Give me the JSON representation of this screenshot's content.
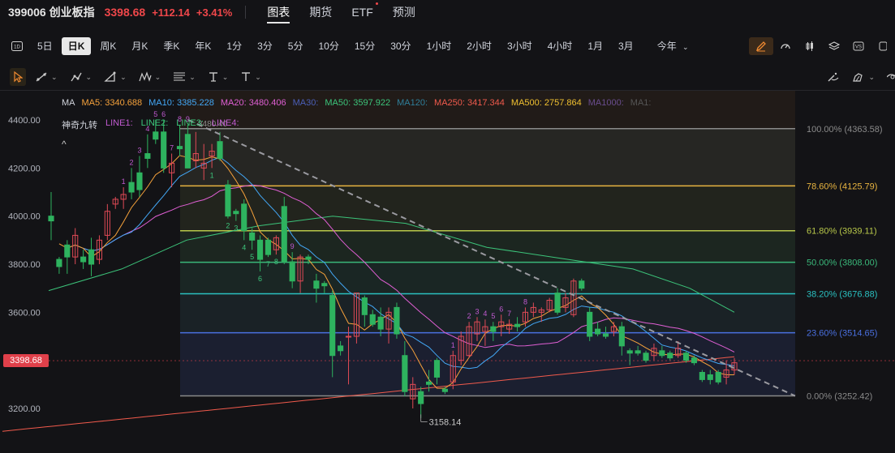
{
  "header": {
    "symbol": "399006 创业板指",
    "price": "3398.68",
    "change": "+112.14",
    "percent": "+3.41%",
    "nav": [
      "图表",
      "期货",
      "ETF",
      "预测"
    ],
    "active_nav": 0,
    "colors": {
      "up": "#f0474a"
    }
  },
  "periods": {
    "items": [
      "5日",
      "日K",
      "周K",
      "月K",
      "季K",
      "年K",
      "1分",
      "3分",
      "5分",
      "10分",
      "15分",
      "30分",
      "1小时",
      "2小时",
      "3小时",
      "4小时",
      "1月",
      "3月"
    ],
    "active": 1,
    "range_select": "今年",
    "left_icon": "1d-icon",
    "right_icons": [
      "pen-icon",
      "gauge-icon",
      "candles-icon",
      "layers-icon",
      "vs-icon",
      "extra-icon"
    ]
  },
  "drawbar": {
    "tools": [
      "cursor-icon",
      "line-icon",
      "brush-icon",
      "triangle-icon",
      "pattern-icon",
      "fib-icon",
      "text-icon",
      "text-style-icon"
    ],
    "right_tools": [
      "magic-icon",
      "alert-icon",
      "eye-icon"
    ]
  },
  "legend": {
    "ma": [
      {
        "label": "MA",
        "color": "#d1d4dc"
      },
      {
        "label": "MA5: 3340.688",
        "color": "#f6a23b"
      },
      {
        "label": "MA10: 3385.228",
        "color": "#43a7f5"
      },
      {
        "label": "MA20: 3480.406",
        "color": "#e05fd4"
      },
      {
        "label": "MA30:",
        "color": "#4b5fb8"
      },
      {
        "label": "MA50: 3597.922",
        "color": "#3cc47a"
      },
      {
        "label": "MA120:",
        "color": "#2f7f9a"
      },
      {
        "label": "MA250: 3417.344",
        "color": "#f05a4c"
      },
      {
        "label": "MA500: 2757.864",
        "color": "#f0c030"
      },
      {
        "label": "MA1000:",
        "color": "#6a4d8f"
      },
      {
        "label": "MA1:",
        "color": "#555"
      }
    ],
    "nine": [
      {
        "label": "神奇九转",
        "color": "#d1d4dc"
      },
      {
        "label": "LINE1:",
        "color": "#c05ad0"
      },
      {
        "label": "LINE2:",
        "color": "#3cc47a"
      },
      {
        "label": "LINE3:",
        "color": "#3cc47a"
      },
      {
        "label": "LINE4:",
        "color": "#c05ad0"
      }
    ],
    "caret": "^"
  },
  "current_price_label": "3398.68",
  "chart_data": {
    "type": "candlestick",
    "y_ticks": [
      {
        "label": "4400.00",
        "value": 4400
      },
      {
        "label": "4200.00",
        "value": 4200
      },
      {
        "label": "4000.00",
        "value": 4000
      },
      {
        "label": "3800.00",
        "value": 3800
      },
      {
        "label": "3600.00",
        "value": 3600
      },
      {
        "label": "3200.00",
        "value": 3200
      }
    ],
    "ylim": [
      3120,
      4470
    ],
    "colors": {
      "up": "#e04a56",
      "down": "#2eb35f"
    },
    "fib_levels": [
      {
        "label": "100.00% (4363.58)",
        "value": 4363.58,
        "color": "#8a8a8a"
      },
      {
        "label": "78.60% (4125.79)",
        "value": 4125.79,
        "color": "#e8b440"
      },
      {
        "label": "61.80% (3939.11)",
        "value": 3939.11,
        "color": "#b8c84a"
      },
      {
        "label": "50.00% (3808.00)",
        "value": 3808.0,
        "color": "#3ab87a"
      },
      {
        "label": "38.20% (3676.88)",
        "value": 3676.88,
        "color": "#2ac0c0"
      },
      {
        "label": "23.60% (3514.65)",
        "value": 3514.65,
        "color": "#4a70e0"
      },
      {
        "label": "0.00% (3252.42)",
        "value": 3252.42,
        "color": "#8a8a8a"
      }
    ],
    "annotations": [
      {
        "text": "3480.40",
        "value": 4380
      },
      {
        "text": "3158.14",
        "value": 3158.14
      }
    ],
    "candles": [
      [
        4000,
        4100,
        3900,
        3980
      ],
      [
        3820,
        3830,
        3760,
        3790
      ],
      [
        3880,
        3900,
        3760,
        3830
      ],
      [
        3830,
        3950,
        3800,
        3920
      ],
      [
        3830,
        3860,
        3780,
        3810
      ],
      [
        3860,
        3910,
        3750,
        3800
      ],
      [
        3820,
        3920,
        3800,
        3900
      ],
      [
        3920,
        4050,
        3900,
        4020
      ],
      [
        4050,
        4080,
        4030,
        4070
      ],
      [
        4070,
        4120,
        4030,
        4090
      ],
      [
        4140,
        4200,
        4070,
        4100
      ],
      [
        4180,
        4250,
        4080,
        4110
      ],
      [
        4260,
        4340,
        4200,
        4240
      ],
      [
        4350,
        4400,
        4300,
        4320
      ],
      [
        4350,
        4400,
        4180,
        4200
      ],
      [
        4180,
        4260,
        4120,
        4220
      ],
      [
        4290,
        4380,
        4250,
        4280
      ],
      [
        4340,
        4380,
        4200,
        4200
      ],
      [
        4230,
        4350,
        4200,
        4260
      ],
      [
        4200,
        4300,
        4150,
        4220
      ],
      [
        4250,
        4300,
        4200,
        4270
      ],
      [
        4310,
        4350,
        4230,
        4240
      ],
      [
        4130,
        4150,
        3990,
        4000
      ],
      [
        4020,
        4030,
        3980,
        4010
      ],
      [
        4050,
        4070,
        3900,
        3940
      ],
      [
        3930,
        3950,
        3860,
        3900
      ],
      [
        3900,
        3920,
        3770,
        3820
      ],
      [
        3900,
        3910,
        3830,
        3840
      ],
      [
        3860,
        3920,
        3840,
        3910
      ],
      [
        4040,
        4080,
        3800,
        3810
      ],
      [
        3810,
        3850,
        3700,
        3730
      ],
      [
        3730,
        3840,
        3680,
        3830
      ],
      [
        3830,
        3840,
        3800,
        3820
      ],
      [
        3730,
        3760,
        3640,
        3700
      ],
      [
        3720,
        3730,
        3680,
        3710
      ],
      [
        3670,
        3690,
        3330,
        3420
      ],
      [
        3460,
        3480,
        3420,
        3440
      ],
      [
        3500,
        3540,
        3300,
        3500
      ],
      [
        3500,
        3680,
        3470,
        3680
      ],
      [
        3660,
        3670,
        3540,
        3590
      ],
      [
        3590,
        3610,
        3540,
        3550
      ],
      [
        3580,
        3620,
        3500,
        3530
      ],
      [
        3530,
        3620,
        3470,
        3600
      ],
      [
        3620,
        3640,
        3490,
        3510
      ],
      [
        3420,
        3480,
        3250,
        3270
      ],
      [
        3240,
        3330,
        3200,
        3300
      ],
      [
        3270,
        3290,
        3160,
        3220
      ],
      [
        3310,
        3360,
        3270,
        3300
      ],
      [
        3400,
        3410,
        3300,
        3330
      ],
      [
        3280,
        3290,
        3260,
        3270
      ],
      [
        3310,
        3440,
        3280,
        3420
      ],
      [
        3400,
        3520,
        3380,
        3500
      ],
      [
        3420,
        3560,
        3410,
        3540
      ],
      [
        3510,
        3580,
        3480,
        3560
      ],
      [
        3520,
        3570,
        3460,
        3540
      ],
      [
        3540,
        3560,
        3480,
        3520
      ],
      [
        3540,
        3590,
        3500,
        3560
      ],
      [
        3530,
        3570,
        3510,
        3550
      ],
      [
        3550,
        3580,
        3520,
        3540
      ],
      [
        3560,
        3620,
        3540,
        3600
      ],
      [
        3600,
        3640,
        3580,
        3620
      ],
      [
        3600,
        3620,
        3560,
        3610
      ],
      [
        3610,
        3660,
        3600,
        3650
      ],
      [
        3680,
        3700,
        3590,
        3600
      ],
      [
        3620,
        3680,
        3600,
        3660
      ],
      [
        3590,
        3740,
        3580,
        3730
      ],
      [
        3730,
        3740,
        3690,
        3700
      ],
      [
        3600,
        3620,
        3480,
        3500
      ],
      [
        3530,
        3560,
        3500,
        3510
      ],
      [
        3510,
        3540,
        3490,
        3500
      ],
      [
        3520,
        3560,
        3500,
        3540
      ],
      [
        3540,
        3560,
        3420,
        3460
      ],
      [
        3440,
        3450,
        3380,
        3430
      ],
      [
        3440,
        3460,
        3420,
        3430
      ],
      [
        3430,
        3440,
        3390,
        3400
      ],
      [
        3420,
        3470,
        3400,
        3450
      ],
      [
        3440,
        3460,
        3410,
        3420
      ],
      [
        3430,
        3440,
        3400,
        3410
      ],
      [
        3420,
        3480,
        3410,
        3450
      ],
      [
        3430,
        3440,
        3390,
        3400
      ],
      [
        3410,
        3420,
        3380,
        3390
      ],
      [
        3350,
        3360,
        3310,
        3320
      ],
      [
        3340,
        3360,
        3300,
        3320
      ],
      [
        3350,
        3360,
        3300,
        3310
      ],
      [
        3330,
        3400,
        3300,
        3360
      ],
      [
        3360,
        3410,
        3340,
        3390
      ]
    ],
    "nine_labels": [
      {
        "i": 9,
        "text": "1",
        "color": "#c05ad0"
      },
      {
        "i": 10,
        "text": "2",
        "color": "#c05ad0"
      },
      {
        "i": 11,
        "text": "3",
        "color": "#c05ad0"
      },
      {
        "i": 12,
        "text": "4",
        "color": "#c05ad0"
      },
      {
        "i": 13,
        "text": "5",
        "color": "#c05ad0"
      },
      {
        "i": 14,
        "text": "6",
        "color": "#c05ad0"
      },
      {
        "i": 15,
        "text": "7",
        "color": "#c05ad0"
      },
      {
        "i": 16,
        "text": "8",
        "color": "#c05ad0"
      },
      {
        "i": 17,
        "text": "9",
        "color": "#c05ad0"
      },
      {
        "i": 20,
        "text": "1",
        "color": "#3cc47a"
      },
      {
        "i": 22,
        "text": "2",
        "color": "#3cc47a"
      },
      {
        "i": 23,
        "text": "3",
        "color": "#3cc47a"
      },
      {
        "i": 24,
        "text": "4",
        "color": "#3cc47a"
      },
      {
        "i": 25,
        "text": "5",
        "color": "#3cc47a"
      },
      {
        "i": 26,
        "text": "6",
        "color": "#3cc47a"
      },
      {
        "i": 27,
        "text": "7",
        "color": "#3cc47a"
      },
      {
        "i": 28,
        "text": "8",
        "color": "#3cc47a"
      },
      {
        "i": 30,
        "text": "9",
        "color": "#c05ad0"
      },
      {
        "i": 50,
        "text": "1",
        "color": "#c05ad0"
      },
      {
        "i": 52,
        "text": "2",
        "color": "#c05ad0"
      },
      {
        "i": 53,
        "text": "3",
        "color": "#c05ad0"
      },
      {
        "i": 54,
        "text": "4",
        "color": "#c05ad0"
      },
      {
        "i": 55,
        "text": "5",
        "color": "#c05ad0"
      },
      {
        "i": 56,
        "text": "6",
        "color": "#c05ad0"
      },
      {
        "i": 57,
        "text": "7",
        "color": "#c05ad0"
      },
      {
        "i": 59,
        "text": "8",
        "color": "#c05ad0"
      }
    ]
  }
}
